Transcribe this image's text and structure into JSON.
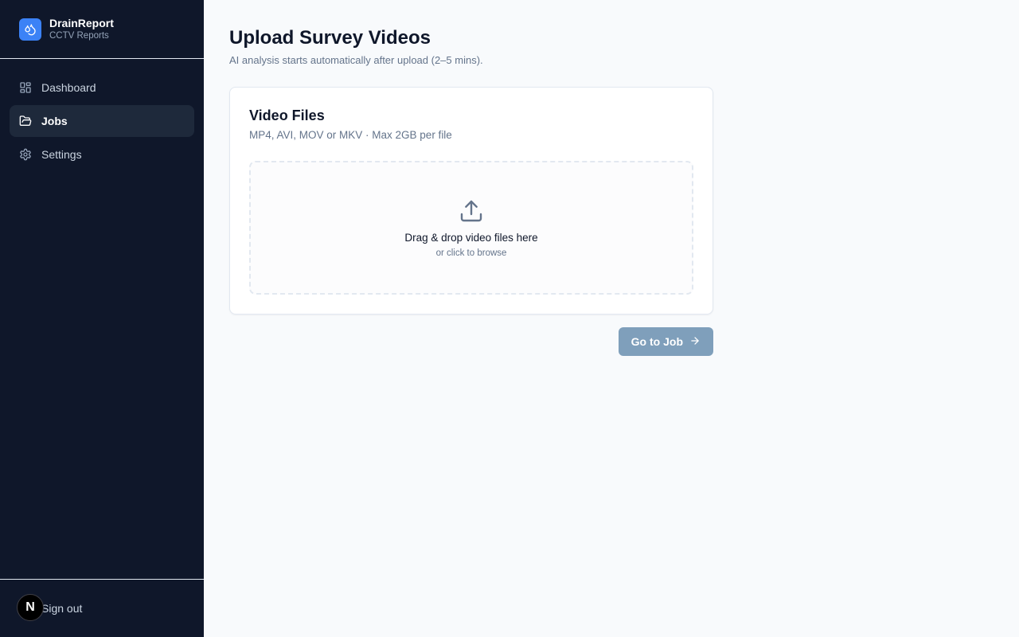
{
  "brand": {
    "name": "DrainReport",
    "subtitle": "CCTV Reports",
    "icon": "drop-icon",
    "color": "#3b82f6"
  },
  "sidebar": {
    "items": [
      {
        "label": "Dashboard",
        "icon": "dashboard-icon",
        "active": false
      },
      {
        "label": "Jobs",
        "icon": "folder-icon",
        "active": true
      },
      {
        "label": "Settings",
        "icon": "gear-icon",
        "active": false
      }
    ],
    "signout_label": "Sign out",
    "badge_letter": "N"
  },
  "page": {
    "title": "Upload Survey Videos",
    "subtitle": "AI analysis starts automatically after upload (2–5 mins)."
  },
  "card": {
    "title": "Video Files",
    "subtitle": "MP4, AVI, MOV or MKV · Max 2GB per file",
    "dropzone_title": "Drag & drop video files here",
    "dropzone_sub": "or click to browse",
    "dropzone_icon": "upload-icon"
  },
  "actions": {
    "go_to_job": "Go to Job",
    "go_to_job_icon": "arrow-right-icon",
    "button_color": "#7f9fbb"
  }
}
